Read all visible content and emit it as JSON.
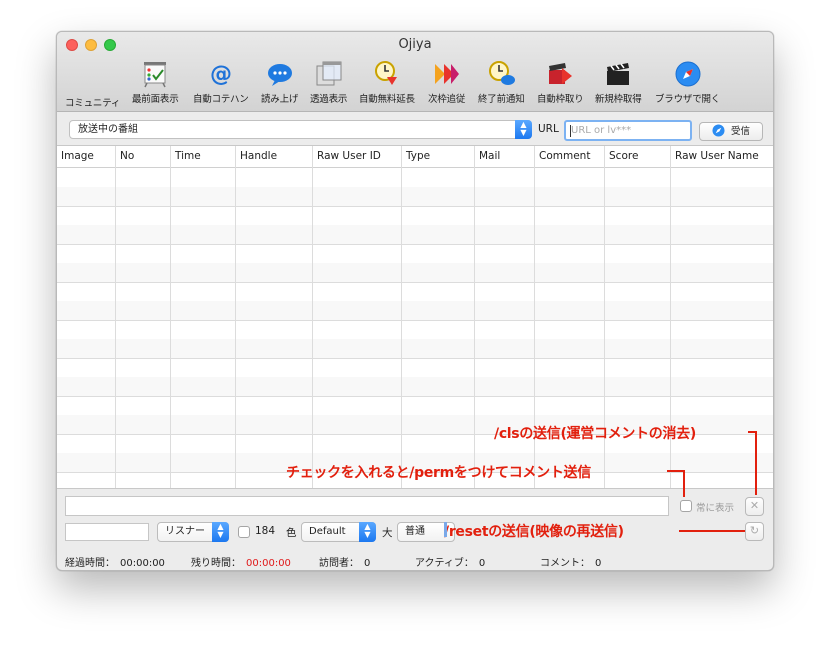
{
  "window": {
    "title": "Ojiya"
  },
  "toolbar": [
    {
      "name": "community",
      "label": "コミュニティ",
      "icon": "none"
    },
    {
      "name": "front",
      "label": "最前面表示",
      "icon": "checklist-board-icon"
    },
    {
      "name": "auto-kotehan",
      "label": "自動コテハン",
      "icon": "at-sign-icon"
    },
    {
      "name": "read-aloud",
      "label": "読み上げ",
      "icon": "speech-bubble-icon"
    },
    {
      "name": "transparent",
      "label": "透過表示",
      "icon": "layered-windows-icon"
    },
    {
      "name": "auto-free-extend",
      "label": "自動無料延長",
      "icon": "clock-down-icon"
    },
    {
      "name": "next-frame",
      "label": "次枠追従",
      "icon": "double-arrow-icon"
    },
    {
      "name": "end-notify",
      "label": "終了前通知",
      "icon": "clock-bubble-icon"
    },
    {
      "name": "auto-record",
      "label": "自動枠取り",
      "icon": "clapper-arrow-icon"
    },
    {
      "name": "new-frame",
      "label": "新規枠取得",
      "icon": "clapperboard-icon"
    },
    {
      "name": "open-browser",
      "label": "ブラウザで開く",
      "icon": "compass-icon"
    }
  ],
  "broadcast": {
    "selected": "放送中の番組"
  },
  "url": {
    "label": "URL",
    "placeholder": "URL or lv***"
  },
  "receive_label": "受信",
  "table": {
    "columns": [
      "Image",
      "No",
      "Time",
      "Handle",
      "Raw User ID",
      "Type",
      "Mail",
      "Comment",
      "Score",
      "Raw User Name"
    ],
    "rows": []
  },
  "comment": {
    "always_show_label": "常に表示"
  },
  "controls": {
    "role": "リスナー",
    "check184": "184",
    "color_label": "色",
    "color_value": "Default",
    "size_label": "大",
    "size_value": "普通"
  },
  "statusbar": {
    "elapsed_label": "経過時間：",
    "elapsed": "00:00:00",
    "remaining_label": "残り時間：",
    "remaining": "00:00:00",
    "visitors_label": "訪問者：",
    "visitors": "0",
    "active_label": "アクティブ：",
    "active": "0",
    "comments_label": "コメント：",
    "comments": "0"
  },
  "annotations": {
    "cls": "/clsの送信(運営コメントの消去)",
    "perm": "チェックを入れると/permをつけてコメント送信",
    "reset": "/resetの送信(映像の再送信)"
  },
  "colors": {
    "annotation": "#e2200e",
    "accent": "#1c78f0",
    "remaining": "#e0191a"
  }
}
